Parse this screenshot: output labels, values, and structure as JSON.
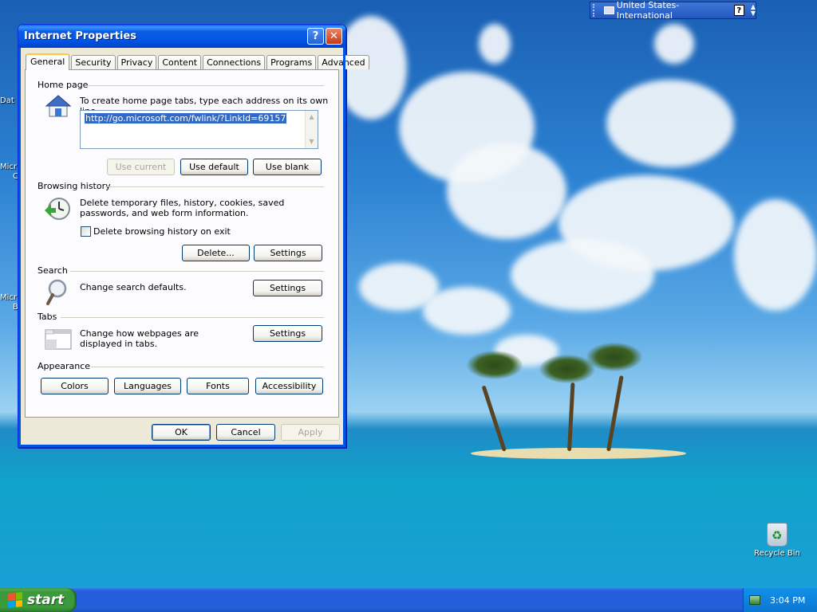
{
  "desktop": {
    "recycle_bin_label": "Recycle Bin",
    "cut_labels": [
      "Dat",
      "Micr",
      "C",
      "Micr",
      "B"
    ]
  },
  "language_bar": {
    "language": "United States-International",
    "help_glyph": "?",
    "options_glyph": "▲▼"
  },
  "dialog": {
    "title": "Internet Properties",
    "help_button": "?",
    "close_button": "✕",
    "tabs": [
      {
        "label": "General",
        "active": true
      },
      {
        "label": "Security"
      },
      {
        "label": "Privacy"
      },
      {
        "label": "Content"
      },
      {
        "label": "Connections"
      },
      {
        "label": "Programs"
      },
      {
        "label": "Advanced"
      }
    ],
    "home_page": {
      "title": "Home page",
      "description": "To create home page tabs, type each address on its own line.",
      "url": "http://go.microsoft.com/fwlink/?LinkId=69157",
      "use_current": "Use current",
      "use_default": "Use default",
      "use_blank": "Use blank"
    },
    "browsing_history": {
      "title": "Browsing history",
      "description": "Delete temporary files, history, cookies, saved passwords, and web form information.",
      "checkbox_label": "Delete browsing history on exit",
      "checkbox_checked": false,
      "delete_button": "Delete...",
      "settings_button": "Settings"
    },
    "search": {
      "title": "Search",
      "description": "Change search defaults.",
      "settings_button": "Settings"
    },
    "tabs_section": {
      "title": "Tabs",
      "description": "Change how webpages are displayed in tabs.",
      "settings_button": "Settings"
    },
    "appearance": {
      "title": "Appearance",
      "colors": "Colors",
      "languages": "Languages",
      "fonts": "Fonts",
      "accessibility": "Accessibility"
    },
    "ok_button": "OK",
    "cancel_button": "Cancel",
    "apply_button": "Apply"
  },
  "taskbar": {
    "start_label": "start",
    "clock": "3:04 PM"
  },
  "colors": {
    "taskbar_blue": "#245edb",
    "start_green": "#3c9a3c",
    "title_blue": "#0055e5"
  }
}
